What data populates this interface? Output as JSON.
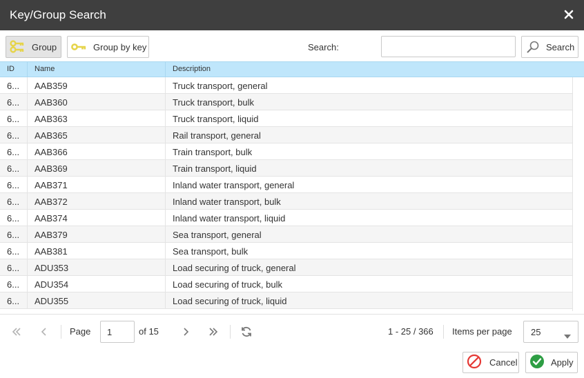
{
  "dialog": {
    "title": "Key/Group Search"
  },
  "toolbar": {
    "group_label": "Group",
    "group_by_key_label": "Group by key",
    "search_label": "Search:",
    "search_value": "",
    "search_button_label": "Search"
  },
  "grid": {
    "columns": [
      "ID",
      "Name",
      "Description"
    ],
    "rows": [
      {
        "id": "6...",
        "name": "AAB359",
        "description": "Truck transport, general"
      },
      {
        "id": "6...",
        "name": "AAB360",
        "description": "Truck transport, bulk"
      },
      {
        "id": "6...",
        "name": "AAB363",
        "description": "Truck transport, liquid"
      },
      {
        "id": "6...",
        "name": "AAB365",
        "description": "Rail transport, general"
      },
      {
        "id": "6...",
        "name": "AAB366",
        "description": "Train transport, bulk"
      },
      {
        "id": "6...",
        "name": "AAB369",
        "description": "Train transport, liquid"
      },
      {
        "id": "6...",
        "name": "AAB371",
        "description": "Inland water transport, general"
      },
      {
        "id": "6...",
        "name": "AAB372",
        "description": "Inland water transport, bulk"
      },
      {
        "id": "6...",
        "name": "AAB374",
        "description": "Inland water transport, liquid"
      },
      {
        "id": "6...",
        "name": "AAB379",
        "description": "Sea transport, general"
      },
      {
        "id": "6...",
        "name": "AAB381",
        "description": "Sea transport, bulk"
      },
      {
        "id": "6...",
        "name": "ADU353",
        "description": "Load securing of truck, general"
      },
      {
        "id": "6...",
        "name": "ADU354",
        "description": "Load securing of truck, bulk"
      },
      {
        "id": "6...",
        "name": "ADU355",
        "description": "Load securing of truck, liquid"
      }
    ]
  },
  "pager": {
    "page_label": "Page",
    "page_value": "1",
    "of_label": "of 15",
    "range_info": "1 - 25 / 366",
    "items_per_page_label": "Items per page",
    "items_per_page_value": "25"
  },
  "footer": {
    "cancel_label": "Cancel",
    "apply_label": "Apply"
  },
  "colors": {
    "titlebar": "#3f3f3f",
    "header": "#bfe6fb",
    "key_icon": "#e6d44a",
    "cancel_icon": "#e53935",
    "apply_icon": "#2e9e44"
  }
}
